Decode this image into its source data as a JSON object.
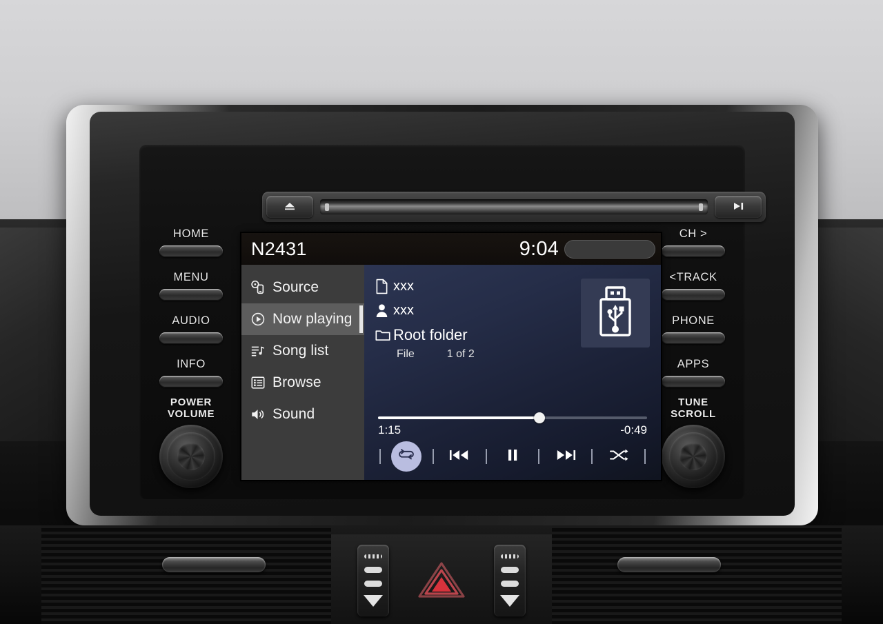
{
  "device": {
    "name": "car-infotainment-head-unit",
    "slot": {
      "eject_icon": "eject-icon",
      "playpause_icon": "play-pause-icon"
    }
  },
  "hard_buttons": {
    "left": [
      {
        "label": "HOME",
        "name": "home-button"
      },
      {
        "label": "MENU",
        "name": "menu-button"
      },
      {
        "label": "AUDIO",
        "name": "audio-button"
      },
      {
        "label": "INFO",
        "name": "info-button"
      }
    ],
    "right": [
      {
        "label": "CH  >",
        "name": "ch-button"
      },
      {
        "label": "<TRACK",
        "name": "track-button"
      },
      {
        "label": "PHONE",
        "name": "phone-button"
      },
      {
        "label": "APPS",
        "name": "apps-button"
      }
    ]
  },
  "knobs": {
    "left": {
      "line1": "POWER",
      "line2": "VOLUME"
    },
    "right": {
      "line1": "TUNE",
      "line2": "SCROLL"
    }
  },
  "screen": {
    "statusbar": {
      "title": "N2431",
      "clock": "9:04",
      "pill_label": ""
    },
    "sidebar": {
      "items": [
        {
          "label": "Source",
          "icon": "disc-source-icon",
          "active": false
        },
        {
          "label": "Now playing",
          "icon": "play-circle-icon",
          "active": true
        },
        {
          "label": "Song list",
          "icon": "song-list-icon",
          "active": false
        },
        {
          "label": "Browse",
          "icon": "browse-list-icon",
          "active": false
        },
        {
          "label": "Sound",
          "icon": "speaker-icon",
          "active": false
        }
      ]
    },
    "now_playing": {
      "track": {
        "icon": "file-icon",
        "value": "xxx"
      },
      "artist": {
        "icon": "person-icon",
        "value": "xxx"
      },
      "folder": {
        "icon": "folder-icon",
        "value": "Root folder"
      },
      "file_label": "File",
      "file_position": "1 of 2",
      "source_icon": "usb-drive-icon",
      "progress": {
        "elapsed": "1:15",
        "remaining": "-0:49",
        "percent": 60
      },
      "transport": [
        {
          "name": "repeat-button",
          "icon": "repeat-icon",
          "active": true
        },
        {
          "name": "previous-button",
          "icon": "previous-track-icon",
          "active": false
        },
        {
          "name": "pause-button",
          "icon": "pause-icon",
          "active": false
        },
        {
          "name": "next-button",
          "icon": "next-track-icon",
          "active": false
        },
        {
          "name": "shuffle-button",
          "icon": "shuffle-icon",
          "active": false
        }
      ]
    }
  },
  "console": {
    "hazard_button": "hazard-warning-button",
    "vent_left": "vent-control-left",
    "vent_right": "vent-control-right"
  },
  "colors": {
    "accent_active": "#b9bde0",
    "screen_bg": "#1c2238",
    "sidebar_bg": "#3c3c3c",
    "sidebar_active_bg": "#5d5d5d",
    "hazard_red": "#d7323c"
  }
}
